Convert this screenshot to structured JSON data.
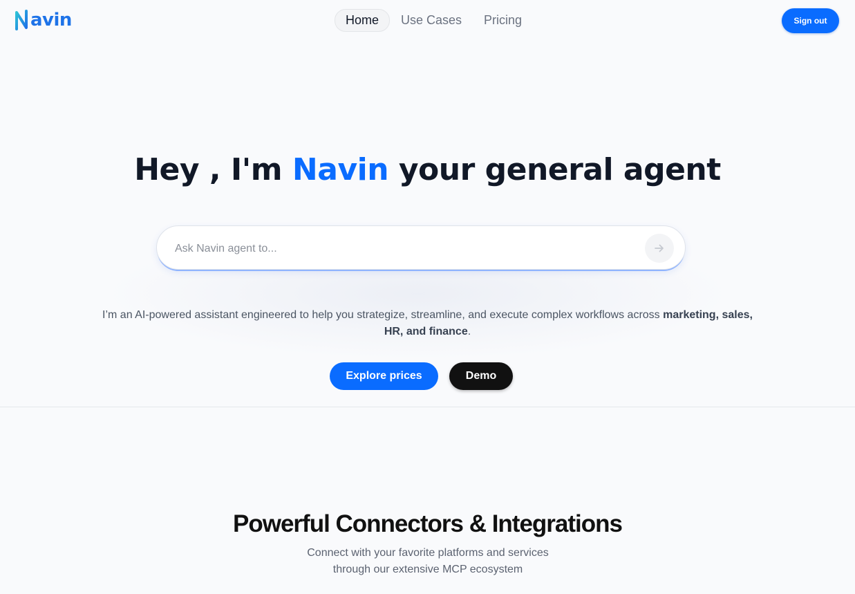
{
  "brand": {
    "name": "Navin",
    "logo_text": "avin",
    "accent_color": "#0a6cff"
  },
  "nav": {
    "items": [
      {
        "label": "Home",
        "active": true
      },
      {
        "label": "Use Cases",
        "active": false
      },
      {
        "label": "Pricing",
        "active": false
      }
    ]
  },
  "header": {
    "signout_label": "Sign out"
  },
  "hero": {
    "title_before": "Hey , I'm ",
    "title_brand": "Navin",
    "title_after": " your general agent",
    "search_placeholder": "Ask Navin agent to...",
    "search_value": "",
    "send_icon": "arrow-right-icon",
    "description_text": "I’m an AI-powered assistant engineered to help you strategize, streamline, and execute complex workflows across ",
    "description_bold": "marketing, sales, HR, and finance",
    "description_end": ".",
    "explore_label": "Explore prices",
    "demo_label": "Demo"
  },
  "integrations": {
    "title": "Powerful Connectors & Integrations",
    "subtitle": "Connect with your favorite platforms and services through our extensive MCP ecosystem"
  }
}
